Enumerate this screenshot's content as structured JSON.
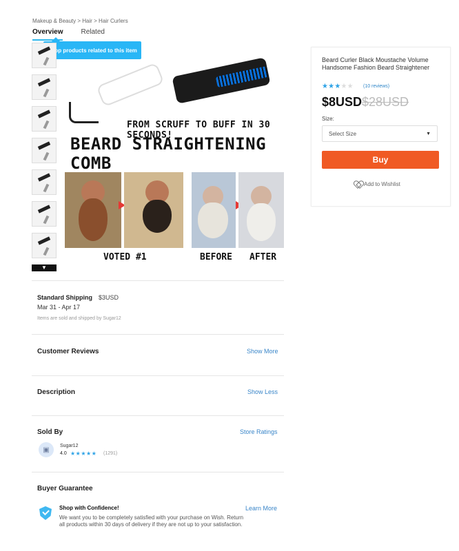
{
  "breadcrumb": "Makeup & Beauty > Hair > Hair Curlers",
  "tabs": {
    "overview": "Overview",
    "related": "Related"
  },
  "tooltip": "Shop products related to this item",
  "gallery": {
    "thumb_count": 7
  },
  "hero": {
    "tagline": "FROM SCRUFF TO BUFF IN 30 SECONDS!",
    "title": "BEARD STRAIGHTENING COMB",
    "captions": {
      "left": "VOTED #1",
      "before": "BEFORE",
      "after": "AFTER"
    }
  },
  "shipping": {
    "title": "Standard Shipping",
    "price": "$3USD",
    "dates": "Mar 31 - Apr 17",
    "note": "Items are sold and shipped by Sugar12"
  },
  "sections": {
    "reviews_title": "Customer Reviews",
    "reviews_link": "Show More",
    "description_title": "Description",
    "description_link": "Show Less",
    "sold_by_title": "Sold By",
    "sold_by_link": "Store Ratings",
    "guarantee_title": "Buyer Guarantee",
    "guarantee_link": "Learn More"
  },
  "seller": {
    "name": "Sugar12",
    "rating": "4.0",
    "count": "(1291)"
  },
  "guarantee": {
    "heading": "Shop with Confidence!",
    "text": "We want you to be completely satisfied with your purchase on Wish. Return all products within 30 days of delivery if they are not up to your satisfaction."
  },
  "product": {
    "title": "Beard Curler Black Moustache Volume Handsome Fashion Beard Straightener",
    "rating": 3,
    "review_count": "(10 reviews)",
    "price": "$8USD",
    "old_price": "$28USD",
    "size_label": "Size:",
    "size_value": "Select Size",
    "buy_label": "Buy",
    "wishlist_label": "Add to Wishlist"
  },
  "colors": {
    "accent": "#2fb7ec",
    "buy_button": "#f05a24",
    "link": "#3a86c9"
  },
  "icons": {
    "down_chevron": "chevron-down-icon",
    "heart": "heart-icon",
    "shield": "shield-icon"
  }
}
